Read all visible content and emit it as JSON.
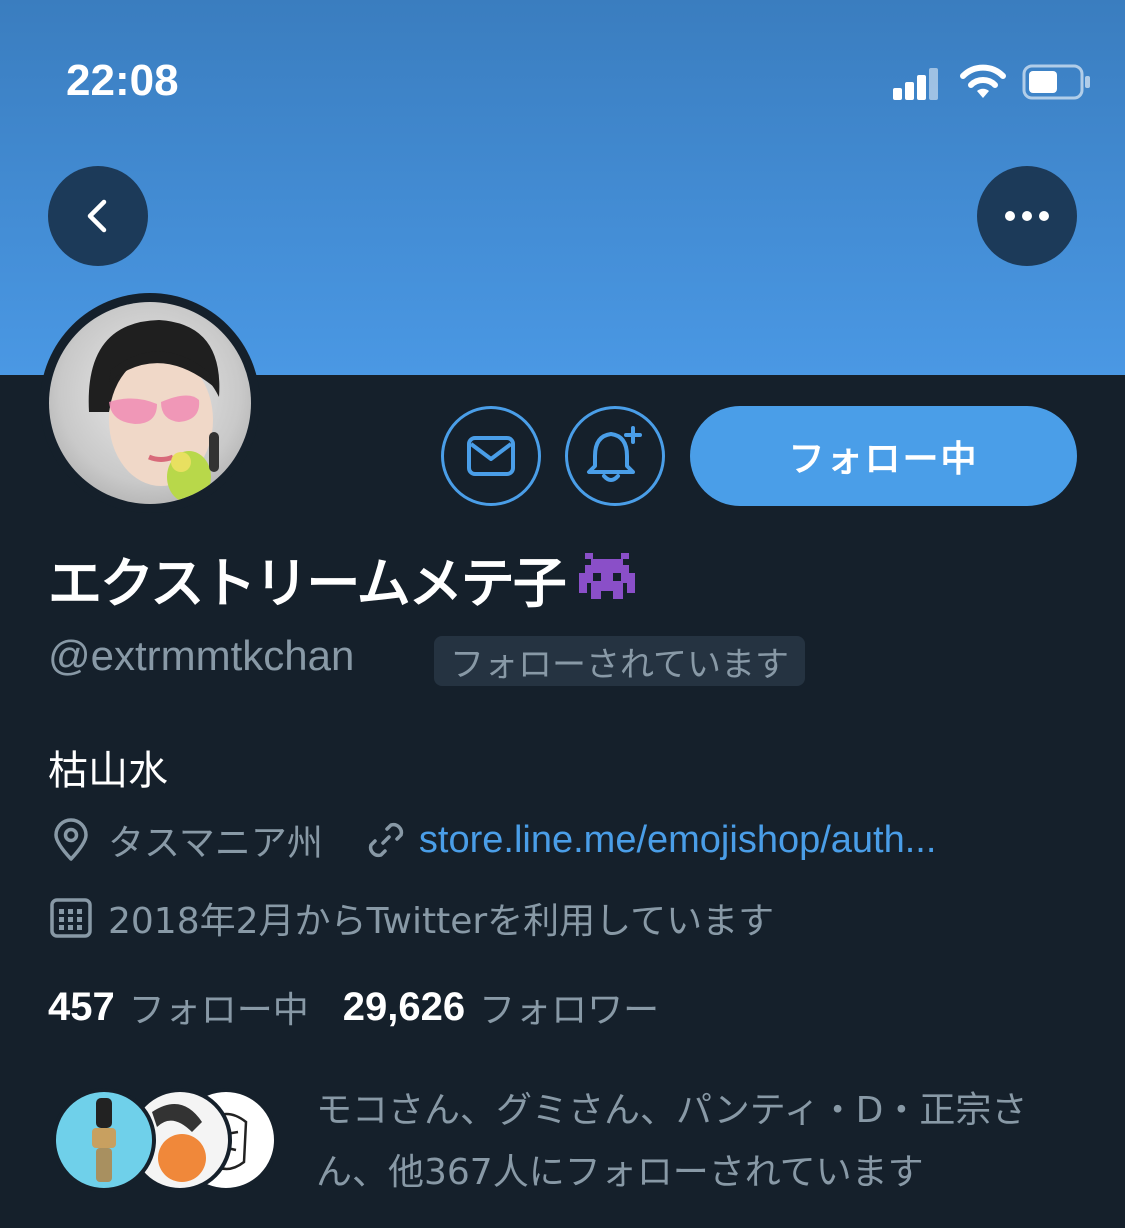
{
  "status_bar": {
    "time": "22:08"
  },
  "profile": {
    "display_name": "エクストリームメテ子",
    "display_name_emoji": "alien-monster-emoji",
    "handle": "@extrmmtkchan",
    "follows_you_label": "フォローされています",
    "bio": "枯山水",
    "location": "タスマニア州",
    "website": "store.line.me/emojishop/auth...",
    "joined": "2018年2月からTwitterを利用しています"
  },
  "actions": {
    "follow_button_label": "フォロー中"
  },
  "stats": {
    "following_count": "457",
    "following_label": "フォロー中",
    "followers_count": "29,626",
    "followers_label": "フォロワー"
  },
  "followers_you_know": {
    "text": "モコさん、グミさん、パンティ・D・正宗さん、他367人にフォローされています"
  },
  "colors": {
    "background": "#15202b",
    "accent": "#4a9ee8",
    "secondary_text": "#8899a6",
    "banner": "#4a98e4"
  }
}
